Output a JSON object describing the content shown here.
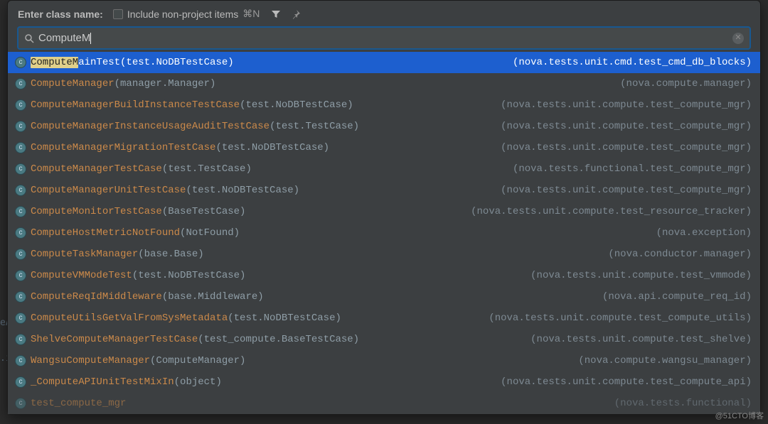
{
  "hdr": {
    "label": "Enter class name:",
    "checkbox_label": "Include non-project items",
    "shortcut": "⌘N"
  },
  "search": {
    "value": "ComputeM",
    "hl_len": 8
  },
  "rows": [
    {
      "kind": "c",
      "class": "ComputeMainTest",
      "paren": "(test.NoDBTestCase)",
      "loc": "(nova.tests.unit.cmd.test_cmd_db_blocks)",
      "selected": true
    },
    {
      "kind": "c",
      "class": "ComputeManager",
      "paren": "(manager.Manager)",
      "loc": "(nova.compute.manager)"
    },
    {
      "kind": "c",
      "class": "ComputeManagerBuildInstanceTestCase",
      "paren": "(test.NoDBTestCase)",
      "loc": "(nova.tests.unit.compute.test_compute_mgr)"
    },
    {
      "kind": "c",
      "class": "ComputeManagerInstanceUsageAuditTestCase",
      "paren": "(test.TestCase)",
      "loc": "(nova.tests.unit.compute.test_compute_mgr)"
    },
    {
      "kind": "c",
      "class": "ComputeManagerMigrationTestCase",
      "paren": "(test.NoDBTestCase)",
      "loc": "(nova.tests.unit.compute.test_compute_mgr)"
    },
    {
      "kind": "c",
      "class": "ComputeManagerTestCase",
      "paren": "(test.TestCase)",
      "loc": "(nova.tests.functional.test_compute_mgr)"
    },
    {
      "kind": "c",
      "class": "ComputeManagerUnitTestCase",
      "paren": "(test.NoDBTestCase)",
      "loc": "(nova.tests.unit.compute.test_compute_mgr)"
    },
    {
      "kind": "c",
      "class": "ComputeMonitorTestCase",
      "paren": "(BaseTestCase)",
      "loc": "(nova.tests.unit.compute.test_resource_tracker)"
    },
    {
      "kind": "c",
      "class": "ComputeHostMetricNotFound",
      "paren": "(NotFound)",
      "loc": "(nova.exception)"
    },
    {
      "kind": "c",
      "class": "ComputeTaskManager",
      "paren": "(base.Base)",
      "loc": "(nova.conductor.manager)"
    },
    {
      "kind": "c",
      "class": "ComputeVMModeTest",
      "paren": "(test.NoDBTestCase)",
      "loc": "(nova.tests.unit.compute.test_vmmode)"
    },
    {
      "kind": "c",
      "class": "ComputeReqIdMiddleware",
      "paren": "(base.Middleware)",
      "loc": "(nova.api.compute_req_id)"
    },
    {
      "kind": "c",
      "class": "ComputeUtilsGetValFromSysMetadata",
      "paren": "(test.NoDBTestCase)",
      "loc": "(nova.tests.unit.compute.test_compute_utils)"
    },
    {
      "kind": "c",
      "class": "ShelveComputeManagerTestCase",
      "paren": "(test_compute.BaseTestCase)",
      "loc": "(nova.tests.unit.compute.test_shelve)"
    },
    {
      "kind": "c",
      "class": "WangsuComputeManager",
      "paren": "(ComputeManager)",
      "loc": "(nova.compute.wangsu_manager)"
    },
    {
      "kind": "c",
      "class": "_ComputeAPIUnitTestMixIn",
      "paren": "(object)",
      "loc": "(nova.tests.unit.compute.test_compute_api)"
    },
    {
      "kind": "c",
      "class": "test_compute_mgr",
      "paren": "",
      "loc": "(nova.tests.functional)",
      "cut": true
    }
  ],
  "bg": {
    "a": "eA",
    "b": ".i"
  },
  "watermark": "@51CTO博客"
}
